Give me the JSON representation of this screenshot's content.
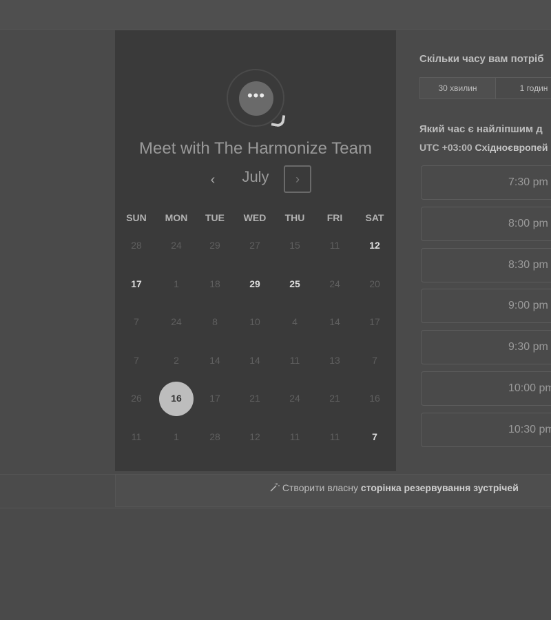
{
  "footer": {
    "icon": "magic-wand-icon",
    "prefix": "Створити власну ",
    "link": "сторінка резервування зустрічей"
  },
  "calendar": {
    "logo_glyph": "•••",
    "title": "Meet with The Harmonize Team",
    "prev_glyph": "‹",
    "next_glyph": "›",
    "month": "July",
    "weekdays": [
      "SUN",
      "MON",
      "TUE",
      "WED",
      "THU",
      "FRI",
      "SAT"
    ],
    "weeks": [
      [
        {
          "d": "28"
        },
        {
          "d": "24"
        },
        {
          "d": "29"
        },
        {
          "d": "27"
        },
        {
          "d": "15"
        },
        {
          "d": "11"
        },
        {
          "d": "12",
          "state": "available"
        }
      ],
      [
        {
          "d": "17",
          "state": "available"
        },
        {
          "d": "1"
        },
        {
          "d": "18"
        },
        {
          "d": "29",
          "state": "available"
        },
        {
          "d": "25",
          "state": "available"
        },
        {
          "d": "24"
        },
        {
          "d": "20"
        }
      ],
      [
        {
          "d": "7"
        },
        {
          "d": "24"
        },
        {
          "d": "8"
        },
        {
          "d": "10"
        },
        {
          "d": "4"
        },
        {
          "d": "14"
        },
        {
          "d": "17"
        }
      ],
      [
        {
          "d": "7"
        },
        {
          "d": "2"
        },
        {
          "d": "14"
        },
        {
          "d": "14"
        },
        {
          "d": "11"
        },
        {
          "d": "13"
        },
        {
          "d": "7"
        }
      ],
      [
        {
          "d": "26"
        },
        {
          "d": "16",
          "state": "selected"
        },
        {
          "d": "17"
        },
        {
          "d": "21"
        },
        {
          "d": "24"
        },
        {
          "d": "21"
        },
        {
          "d": "16"
        }
      ],
      [
        {
          "d": "11"
        },
        {
          "d": "1"
        },
        {
          "d": "28"
        },
        {
          "d": "12"
        },
        {
          "d": "11"
        },
        {
          "d": "11"
        },
        {
          "d": "7",
          "state": "available"
        }
      ]
    ]
  },
  "booking": {
    "duration_question": "Скільки часу вам потріб",
    "durations": [
      "30 хвилин",
      "1 годин"
    ],
    "time_question": "Який час є найліпшим д",
    "tz_offset": "UTC +03:00",
    "tz_name": "Східноєвропей",
    "slots": [
      "7:30 pm",
      "8:00 pm",
      "8:30 pm",
      "9:00 pm",
      "9:30 pm",
      "10:00 pm",
      "10:30 pm"
    ]
  }
}
